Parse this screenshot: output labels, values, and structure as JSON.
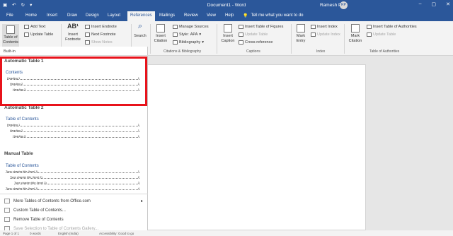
{
  "titlebar": {
    "doc_title": "Document1 - Word",
    "user_name": "Ramesh Post",
    "avatar_initials": "RP",
    "minimize": "–",
    "restore": "▢",
    "close": "✕"
  },
  "tabs": [
    "File",
    "Home",
    "Insert",
    "Draw",
    "Design",
    "Layout",
    "References",
    "Mailings",
    "Review",
    "View",
    "Help"
  ],
  "active_tab": "References",
  "tell_me": "Tell me what you want to do",
  "ribbon": {
    "table_of_contents": "Table of Contents",
    "add_text": "Add Text",
    "update_table": "Update Table",
    "insert_footnote": "Insert Footnote",
    "insert_endnote": "Insert Endnote",
    "next_footnote": "Next Footnote",
    "show_notes": "Show Notes",
    "search": "Search",
    "insert_citation": "Insert Citation",
    "manage_sources": "Manage Sources",
    "style_label": "Style:",
    "style_value": "APA",
    "bibliography": "Bibliography",
    "insert_caption": "Insert Caption",
    "insert_table_of_figures": "Insert Table of Figures",
    "update_table_captions": "Update Table",
    "cross_reference": "Cross-reference",
    "mark_entry": "Mark Entry",
    "insert_index": "Insert Index",
    "update_index": "Update Index",
    "mark_citation": "Mark Citation",
    "insert_table_of_authorities": "Insert Table of Authorities",
    "update_table_authorities": "Update Table",
    "groups": {
      "citations": "Citations & Bibliography",
      "captions": "Captions",
      "index": "Index",
      "authorities": "Table of Authorities"
    }
  },
  "panel": {
    "builtin": "Built-in",
    "auto1": {
      "title": "Automatic Table 1",
      "toc_title": "Contents",
      "lines": [
        {
          "text": "Heading 1",
          "page": "1"
        },
        {
          "text": "Heading 2",
          "page": "1"
        },
        {
          "text": "Heading 3",
          "page": "1"
        }
      ]
    },
    "auto2": {
      "title": "Automatic Table 2",
      "toc_title": "Table of Contents",
      "lines": [
        {
          "text": "Heading 1",
          "page": "1"
        },
        {
          "text": "Heading 2",
          "page": "1"
        },
        {
          "text": "Heading 3",
          "page": "1"
        }
      ]
    },
    "manual": {
      "title": "Manual Table",
      "toc_title": "Table of Contents",
      "lines": [
        {
          "text": "Type chapter title (level 1)",
          "page": "1"
        },
        {
          "text": "Type chapter title (level 2)",
          "page": "2"
        },
        {
          "text": "Type chapter title (level 3)",
          "page": "3"
        },
        {
          "text": "Type chapter title (level 1)",
          "page": "4"
        }
      ]
    },
    "menu": {
      "more": "More Tables of Contents from Office.com",
      "custom": "Custom Table of Contents...",
      "remove": "Remove Table of Contents",
      "save": "Save Selection to Table of Contents Gallery..."
    }
  },
  "status": {
    "page": "Page 1 of 1",
    "words": "0 words",
    "language": "English (India)",
    "accessibility": "Accessibility: Good to go"
  }
}
